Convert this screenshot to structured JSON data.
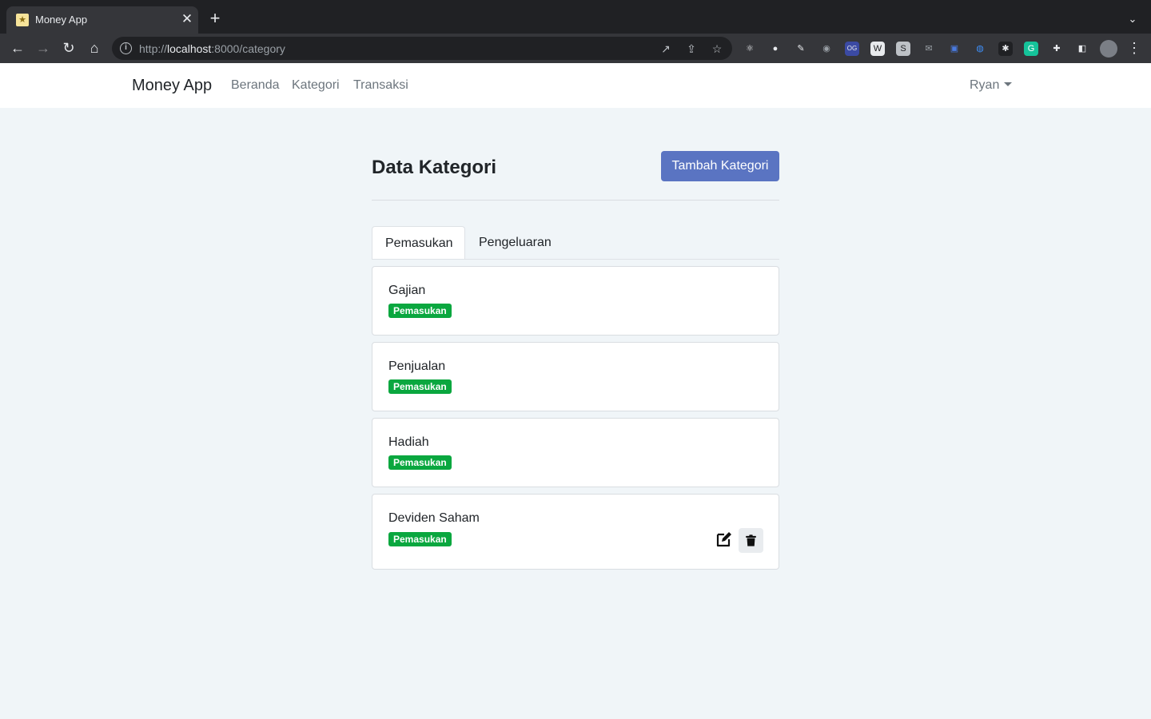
{
  "browser": {
    "tab_title": "Money App",
    "tab_close": "✕",
    "new_tab": "+",
    "tab_list": "⌄",
    "url_scheme": "http://",
    "url_host": "localhost",
    "url_path": ":8000/category",
    "nav": {
      "back": "←",
      "forward": "→",
      "reload": "↻",
      "home": "⌂",
      "menu": "⋮"
    },
    "omnibox_actions": [
      "↗",
      "⇪",
      "☆"
    ],
    "extensions": [
      {
        "icon": "react-devtools-icon",
        "glyph": "⚛",
        "color": "#e8eaed",
        "bg": "transparent"
      },
      {
        "icon": "circle-ext-icon",
        "glyph": "●",
        "color": "#e8eaed",
        "bg": "transparent"
      },
      {
        "icon": "pen-ext-icon",
        "glyph": "✎",
        "color": "#e8eaed",
        "bg": "transparent"
      },
      {
        "icon": "camera-ext-icon",
        "glyph": "◉",
        "color": "#9aa0a6",
        "bg": "transparent"
      },
      {
        "icon": "og-ext-icon",
        "glyph": "OG",
        "color": "#e8eaed",
        "bg": "#3b4aa3"
      },
      {
        "icon": "w-ext-icon",
        "glyph": "W",
        "color": "#202124",
        "bg": "#e8eaed"
      },
      {
        "icon": "s-ext-icon",
        "glyph": "S",
        "color": "#202124",
        "bg": "#bdc1c6"
      },
      {
        "icon": "mail-ext-icon",
        "glyph": "✉",
        "color": "#9aa0a6",
        "bg": "transparent"
      },
      {
        "icon": "doc-ext-icon",
        "glyph": "▣",
        "color": "#4a7be0",
        "bg": "transparent"
      },
      {
        "icon": "globe-ext-icon",
        "glyph": "◍",
        "color": "#3e8ef7",
        "bg": "transparent"
      },
      {
        "icon": "gear-ext-icon",
        "glyph": "✱",
        "color": "#e8eaed",
        "bg": "#202124"
      },
      {
        "icon": "grammarly-icon",
        "glyph": "G",
        "color": "#ffffff",
        "bg": "#15c39a"
      },
      {
        "icon": "puzzle-icon",
        "glyph": "✚",
        "color": "#e8eaed",
        "bg": "transparent"
      },
      {
        "icon": "side-panel-icon",
        "glyph": "◧",
        "color": "#e8eaed",
        "bg": "transparent"
      }
    ]
  },
  "navbar": {
    "brand": "Money App",
    "links": [
      "Beranda",
      "Kategori",
      "Transaksi"
    ],
    "user": "Ryan"
  },
  "page": {
    "title": "Data Kategori",
    "add_button": "Tambah Kategori"
  },
  "tabs": [
    "Pemasukan",
    "Pengeluaran"
  ],
  "categories": [
    {
      "name": "Gajian",
      "badge": "Pemasukan"
    },
    {
      "name": "Penjualan",
      "badge": "Pemasukan"
    },
    {
      "name": "Hadiah",
      "badge": "Pemasukan"
    },
    {
      "name": "Deviden Saham",
      "badge": "Pemasukan"
    }
  ],
  "colors": {
    "primary": "#5a74c2",
    "success": "#0aa73f",
    "page_bg": "#f0f5f8"
  }
}
